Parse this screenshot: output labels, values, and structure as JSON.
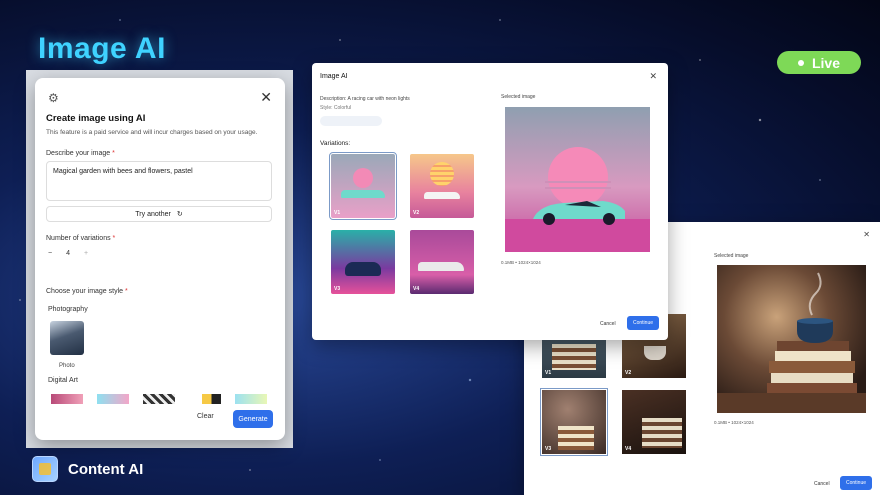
{
  "header": {
    "title": "Image AI",
    "live_label": "Live"
  },
  "footer": {
    "brand": "Content AI"
  },
  "create_dialog": {
    "title": "Create image using AI",
    "description": "This feature is a paid service and will incur charges based on your usage.",
    "describe_label": "Describe your image",
    "required_mark": "*",
    "prompt_value": "Magical garden with bees and flowers, pastel",
    "try_another": "Try another",
    "variations_label": "Number of variations",
    "variations_minus": "−",
    "variations_value": "4",
    "variations_plus": "+",
    "style_label": "Choose your image style",
    "photography_label": "Photography",
    "photo_label": "Photo",
    "digital_art_label": "Digital Art",
    "clear_label": "Clear",
    "generate_label": "Generate"
  },
  "image_ai_dialog": {
    "title": "Image AI",
    "description_line": "Description:  A racing car with neon lights",
    "style_line": "Style: Colorful",
    "variations_label": "Variations:",
    "variations": [
      "V1",
      "V2",
      "V3",
      "V4"
    ],
    "selected_label": "Selected image",
    "selected_meta": "0.1MB • 1024×1024",
    "cancel_label": "Cancel",
    "continue_label": "Continue"
  },
  "right_dialog": {
    "selected_label": "Selected image",
    "selected_meta": "0.1MB • 1024×1024",
    "variations": [
      "V1",
      "V2",
      "V3",
      "V4"
    ],
    "cancel_label": "Cancel",
    "continue_label": "Continue"
  },
  "colors": {
    "accent": "#2f6fea",
    "live": "#7ed957",
    "brand": "#3fd3ff"
  }
}
